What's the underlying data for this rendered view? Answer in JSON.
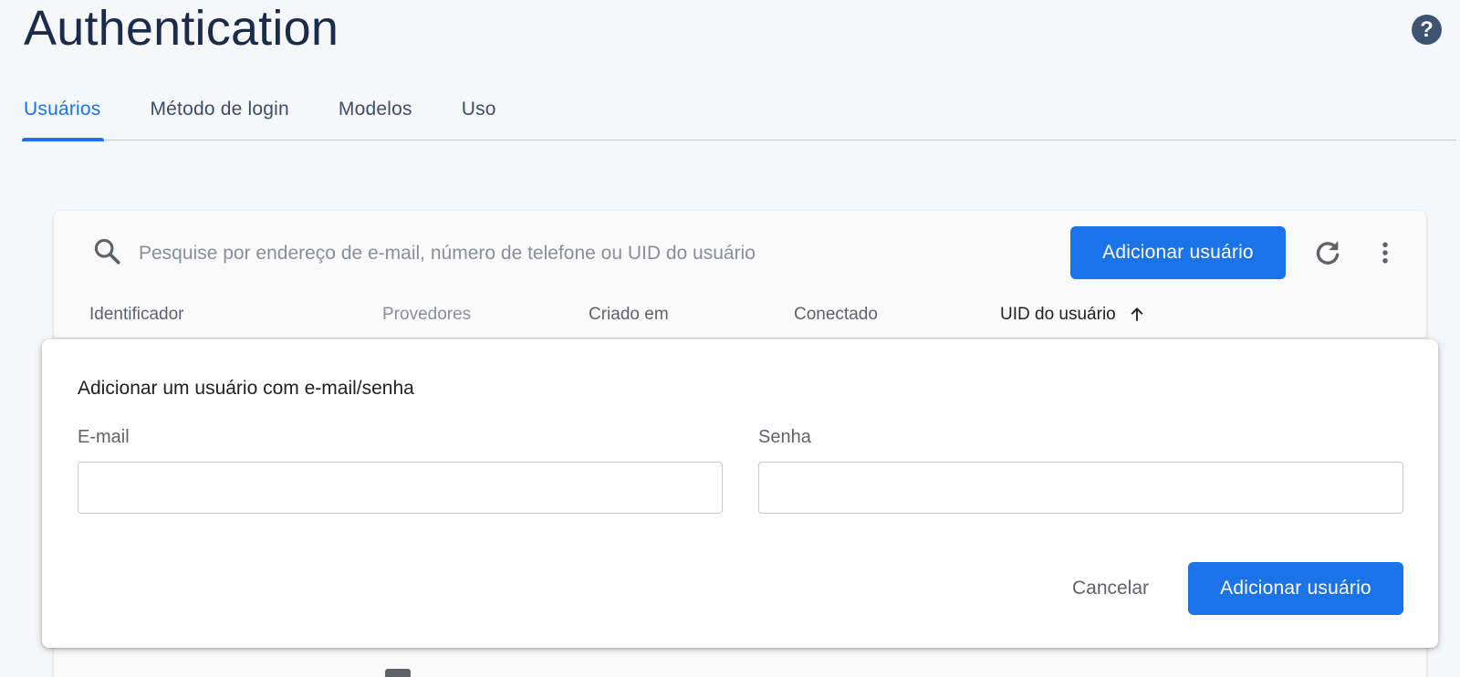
{
  "page": {
    "title": "Authentication",
    "help_icon": "help-circle-icon"
  },
  "tabs": [
    {
      "label": "Usuários",
      "active": true
    },
    {
      "label": "Método de login",
      "active": false
    },
    {
      "label": "Modelos",
      "active": false
    },
    {
      "label": "Uso",
      "active": false
    }
  ],
  "toolbar": {
    "search_icon": "search-icon",
    "search_placeholder": "Pesquise por endereço de e-mail, número de telefone ou UID do usuário",
    "add_user_label": "Adicionar usuário",
    "refresh_icon": "refresh-icon",
    "more_icon": "more-vert-icon"
  },
  "table": {
    "columns": [
      {
        "label": "Identificador",
        "sorted": false
      },
      {
        "label": "Provedores",
        "sorted": false
      },
      {
        "label": "Criado em",
        "sorted": false
      },
      {
        "label": "Conectado",
        "sorted": false
      },
      {
        "label": "UID do usuário",
        "sorted": true,
        "sort_direction": "ascending"
      }
    ]
  },
  "dialog": {
    "title": "Adicionar um usuário com e-mail/senha",
    "email_label": "E-mail",
    "email_value": "",
    "password_label": "Senha",
    "password_value": "",
    "cancel_label": "Cancelar",
    "submit_label": "Adicionar usuário"
  },
  "colors": {
    "accent": "#1a73e8",
    "title": "#1a2c4a",
    "background": "#f6f7f9"
  }
}
